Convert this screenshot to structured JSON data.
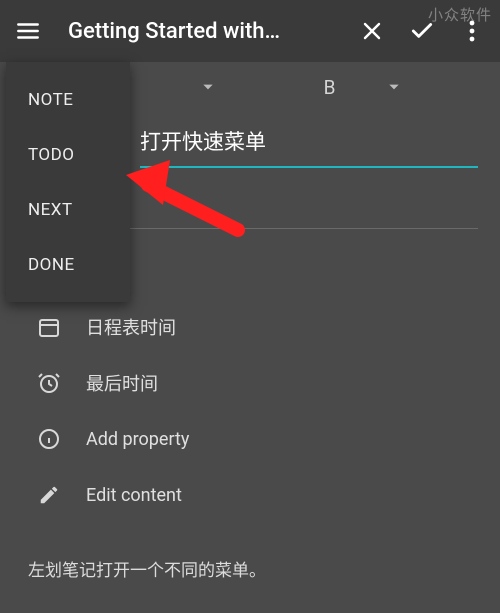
{
  "watermark": "小众软件",
  "header": {
    "title": "Getting Started with…"
  },
  "format_item_b": "B",
  "input": {
    "value": "打开快速菜单"
  },
  "items": [
    {
      "icon": "calendar-icon",
      "label": "日程表时间"
    },
    {
      "icon": "alarm-icon",
      "label": "最后时间"
    },
    {
      "icon": "info-icon",
      "label": "Add property"
    },
    {
      "icon": "pencil-icon",
      "label": "Edit content"
    }
  ],
  "menu": {
    "items": [
      "NOTE",
      "TODO",
      "NEXT",
      "DONE"
    ]
  },
  "hint": "左划笔记打开一个不同的菜单。"
}
